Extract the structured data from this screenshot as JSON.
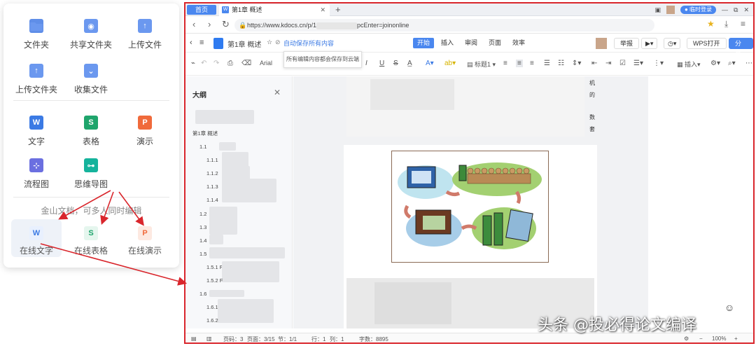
{
  "panel": {
    "file_items": [
      {
        "label": "文件夹",
        "icon": "folder-icon"
      },
      {
        "label": "共享文件夹",
        "icon": "shared-folder-icon"
      },
      {
        "label": "上传文件",
        "icon": "upload-file-icon"
      },
      {
        "label": "上传文件夹",
        "icon": "upload-folder-icon"
      },
      {
        "label": "收集文件",
        "icon": "collect-file-icon"
      }
    ],
    "new_items": [
      {
        "label": "文字",
        "icon": "writer-icon",
        "glyph": "W",
        "color": "#3b7ae4"
      },
      {
        "label": "表格",
        "icon": "spreadsheet-icon",
        "glyph": "S",
        "color": "#1fa56c"
      },
      {
        "label": "演示",
        "icon": "presentation-icon",
        "glyph": "P",
        "color": "#f06a3b"
      },
      {
        "label": "流程图",
        "icon": "flowchart-icon",
        "glyph": "⊹",
        "color": "#6b6fe0"
      },
      {
        "label": "思维导图",
        "icon": "mindmap-icon",
        "glyph": "⊶",
        "color": "#15b39c"
      }
    ],
    "hint": "金山文档，可多人同时编辑",
    "online_items": [
      {
        "label": "在线文字",
        "icon": "online-writer-icon",
        "glyph": "W",
        "color": "#3b7ae4",
        "bg": "#e8f0fe"
      },
      {
        "label": "在线表格",
        "icon": "online-spreadsheet-icon",
        "glyph": "S",
        "color": "#1fa56c",
        "bg": "#e5f6ee"
      },
      {
        "label": "在线演示",
        "icon": "online-presentation-icon",
        "glyph": "P",
        "color": "#f06a3b",
        "bg": "#fde9e1"
      }
    ]
  },
  "browser": {
    "tab_home": "首页",
    "tab_doc": "第1章 概述",
    "login": "临时登录",
    "url_prefix": "https://www.kdocs.cn/p/1",
    "url_suffix": "pcEnter=joinonline",
    "doc_title": "第1章 概述",
    "autosave": "自动保存所有内容",
    "tooltip": "所有编辑内容都会保存到云端",
    "menu_tabs": [
      "开始",
      "插入",
      "审阅",
      "页面",
      "效率"
    ],
    "active_tab": "开始",
    "btn_report": "举报",
    "btn_wps": "WPS打开",
    "btn_share": "分享",
    "font_name": "Arial",
    "heading_style": "标题1",
    "insert_label": "插入",
    "outline_title": "大纲",
    "outline": [
      "第1章 概述",
      "1.1",
      "1.1.1",
      "1.1.2",
      "1.1.3",
      "1.1.4",
      "1.2",
      "1.3",
      "1.4",
      "1.5",
      "1.5.1 F",
      "1.5.2 F",
      "1.6",
      "1.6.1",
      "1.6.2"
    ],
    "side_chars": [
      "机",
      "的",
      "数",
      "套"
    ],
    "status": {
      "page_code": "页码：3",
      "page": "页面：3/15",
      "section": "节：1/1",
      "row": "行：1",
      "col": "列：1",
      "words": "字数：8895",
      "zoom": "100%"
    }
  },
  "watermark": "头条 @投必得论文编译",
  "colors": {
    "accent": "#4a87ef",
    "frame": "#d9262c"
  }
}
